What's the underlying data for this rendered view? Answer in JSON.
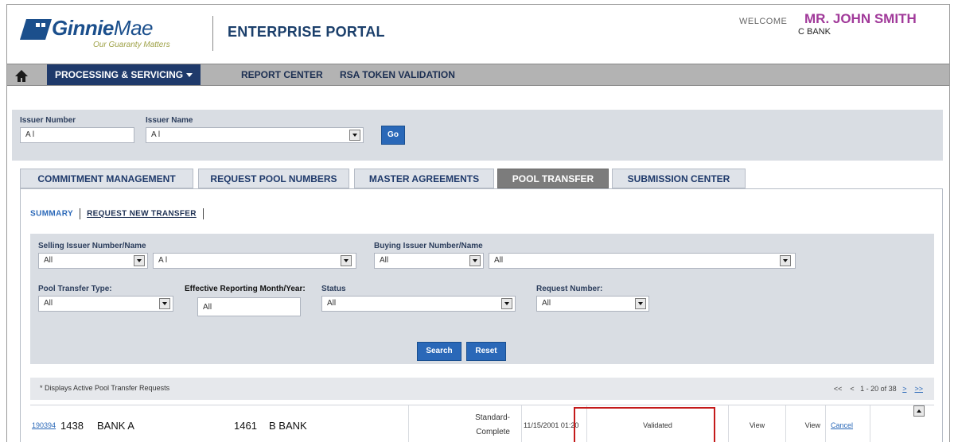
{
  "header": {
    "logo_name": "Ginnie",
    "logo_name_suffix": "Mae",
    "logo_tagline": "Our Guaranty Matters",
    "portal_title": "ENTERPRISE PORTAL",
    "welcome_label": "WELCOME",
    "user_name": "MR. JOHN SMITH",
    "user_org": "C BANK"
  },
  "topnav": {
    "home_icon": "home-icon",
    "items": [
      {
        "label": "PROCESSING & SERVICING",
        "active": true
      },
      {
        "label": "REPORT CENTER",
        "active": false
      },
      {
        "label": "RSA TOKEN VALIDATION",
        "active": false
      }
    ]
  },
  "issuer_bar": {
    "issuer_number_label": "Issuer Number",
    "issuer_number_value": "A l",
    "issuer_name_label": "Issuer Name",
    "issuer_name_value": "A l",
    "go_label": "Go"
  },
  "tabs": [
    {
      "label": "COMMITMENT MANAGEMENT",
      "active": false
    },
    {
      "label": "REQUEST POOL NUMBERS",
      "active": false
    },
    {
      "label": "MASTER AGREEMENTS",
      "active": false
    },
    {
      "label": "POOL TRANSFER",
      "active": true
    },
    {
      "label": "SUBMISSION CENTER",
      "active": false
    }
  ],
  "subnav": {
    "summary": "SUMMARY",
    "request_new": "REQUEST NEW TRANSFER"
  },
  "filters": {
    "selling_label": "Selling Issuer Number/Name",
    "selling_number": "All",
    "selling_name": "A l",
    "buying_label": "Buying Issuer Number/Name",
    "buying_number": "All",
    "buying_name": "All",
    "type_label": "Pool Transfer Type:",
    "type_value": "All",
    "effective_label": "Effective Reporting Month/Year:",
    "effective_value": "All",
    "status_label": "Status",
    "status_value": "All",
    "request_label": "Request Number:",
    "request_value": "All",
    "search_label": "Search",
    "reset_label": "Reset"
  },
  "results": {
    "note": "* Displays Active Pool Transfer Requests",
    "pager_first": "<<",
    "pager_prev": "<",
    "pager_range": "1 - 20 of 38",
    "pager_next": ">",
    "pager_last": ">>"
  },
  "rows": [
    {
      "request_number": "190394",
      "seller_number": "1438",
      "seller_name": "BANK A",
      "buyer_number": "1461",
      "buyer_name": "B BANK",
      "type_line1": "Standard-",
      "type_line2": "Complete",
      "date": "11/15/2001 01:20",
      "status": "Validated",
      "view1": "View",
      "view2": "View",
      "cancel": "Cancel"
    }
  ],
  "colors": {
    "nav_active": "#1f3a6b",
    "accent_blue": "#2a68b8",
    "user_name": "#a13a9a",
    "highlight_box": "#c41a1a"
  }
}
